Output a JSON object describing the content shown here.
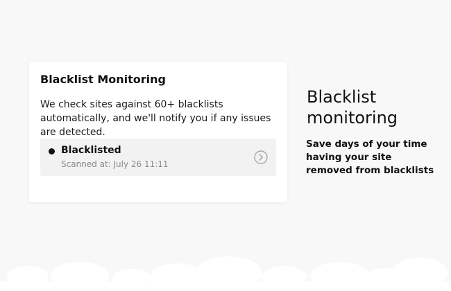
{
  "card": {
    "title": "Blacklist Monitoring",
    "description": "We check sites against 60+ blacklists automatically, and we'll notify you if any issues are detected.",
    "status": {
      "label": "Blacklisted",
      "scanned_at": "Scanned at: July 26  11:11",
      "dot_color": "#111111",
      "arrow_icon": "chevron-right-circle-icon"
    }
  },
  "side": {
    "heading": "Blacklist monitoring",
    "text": "Save days of your time having your site removed from blacklists"
  },
  "colors": {
    "background": "#f8f8f8",
    "card": "#ffffff",
    "status_row": "#f2f2f2",
    "muted_text": "#8a8a8a"
  }
}
